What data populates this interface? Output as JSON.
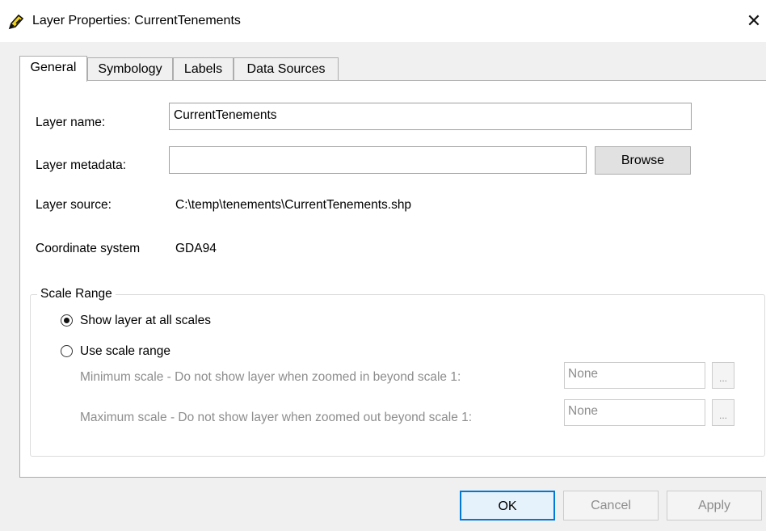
{
  "window": {
    "title": "Layer Properties: CurrentTenements",
    "close_glyph": "✕",
    "app_icon": "qgis-style-pencil-icon"
  },
  "tabs": [
    {
      "label": "General",
      "active": true
    },
    {
      "label": "Symbology",
      "active": false
    },
    {
      "label": "Labels",
      "active": false
    },
    {
      "label": "Data Sources",
      "active": false
    }
  ],
  "general": {
    "layer_name_label": "Layer name:",
    "layer_name_value": "CurrentTenements",
    "layer_metadata_label": "Layer metadata:",
    "layer_metadata_value": "",
    "browse_label": "Browse",
    "layer_source_label": "Layer source:",
    "layer_source_value": "C:\\temp\\tenements\\CurrentTenements.shp",
    "coord_label": "Coordinate system",
    "coord_value": "GDA94"
  },
  "scale_range": {
    "title": "Scale Range",
    "option_all": "Show layer at all scales",
    "option_range": "Use scale range",
    "selected": "all",
    "min_label": "Minimum scale - Do not show layer when zoomed in beyond scale 1:",
    "min_value": "None",
    "max_label": "Maximum scale - Do not show layer when zoomed out beyond scale 1:",
    "max_value": "None",
    "ellipsis": "..."
  },
  "footer": {
    "ok": "OK",
    "cancel": "Cancel",
    "apply": "Apply"
  },
  "colors": {
    "accent_border": "#0078d7",
    "ok_bg": "#e5f1fb"
  }
}
